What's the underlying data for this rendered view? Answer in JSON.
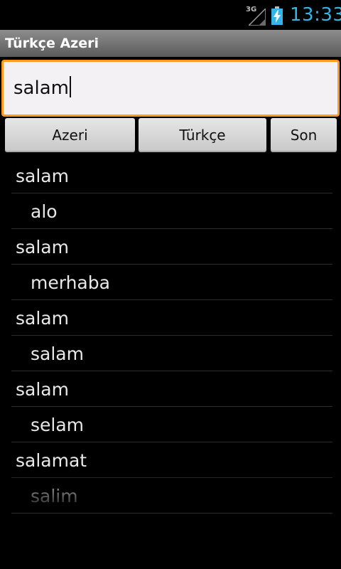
{
  "status_bar": {
    "network_label": "3G",
    "time": "13:33",
    "accent_color": "#33b5e5"
  },
  "app": {
    "title": "Türkçe Azeri"
  },
  "search": {
    "value": "salam",
    "focus_color": "#ff9a1c"
  },
  "buttons": {
    "azeri": "Azeri",
    "turkce": "Türkçe",
    "son": "Son"
  },
  "results": [
    {
      "kind": "term",
      "text": "salam"
    },
    {
      "kind": "translation",
      "text": "alo"
    },
    {
      "kind": "term",
      "text": "salam"
    },
    {
      "kind": "translation",
      "text": "merhaba"
    },
    {
      "kind": "term",
      "text": "salam"
    },
    {
      "kind": "translation",
      "text": "salam"
    },
    {
      "kind": "term",
      "text": "salam"
    },
    {
      "kind": "translation",
      "text": "selam"
    },
    {
      "kind": "term",
      "text": "salamat"
    },
    {
      "kind": "translation",
      "text": "salim"
    }
  ]
}
